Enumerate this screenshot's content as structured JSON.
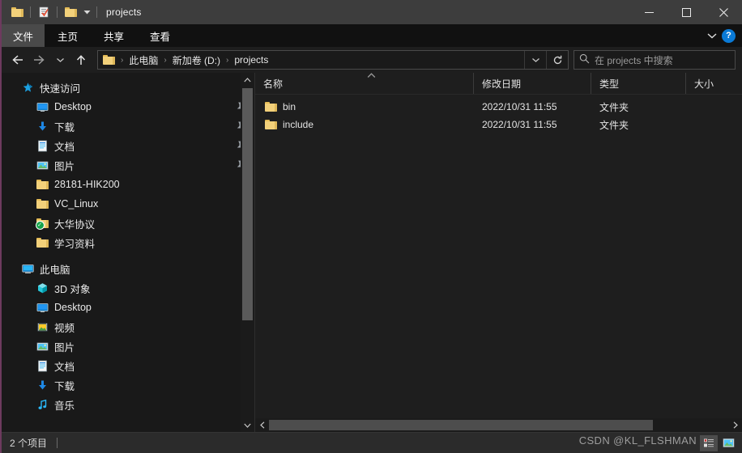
{
  "titlebar": {
    "title": "projects",
    "quick_access": [
      {
        "name": "folder-icon",
        "label": "folder"
      },
      {
        "name": "properties-icon",
        "label": "properties"
      },
      {
        "name": "new-folder-icon",
        "label": "new folder"
      }
    ],
    "minimize_label": "─",
    "maximize_label": "□",
    "close_label": "✕"
  },
  "ribbon": {
    "tabs": [
      {
        "label": "文件",
        "active": true
      },
      {
        "label": "主页",
        "active": false
      },
      {
        "label": "共享",
        "active": false
      },
      {
        "label": "查看",
        "active": false
      }
    ],
    "collapse_label": "⌄",
    "help_label": "?"
  },
  "address": {
    "back_label": "←",
    "forward_label": "→",
    "recent_label": "⌄",
    "up_label": "↑",
    "breadcrumb": [
      "此电脑",
      "新加卷 (D:)",
      "projects"
    ],
    "separator": "›",
    "history_label": "⌄",
    "refresh_label": "↻"
  },
  "search": {
    "placeholder": "在 projects 中搜索",
    "icon": "search-icon"
  },
  "sidebar": {
    "groups": [
      {
        "header": {
          "label": "快速访问",
          "icon": "star-pin-icon"
        },
        "items": [
          {
            "label": "Desktop",
            "icon": "monitor-icon",
            "pinned": true
          },
          {
            "label": "下载",
            "icon": "download-icon",
            "pinned": true
          },
          {
            "label": "文档",
            "icon": "document-icon",
            "pinned": true
          },
          {
            "label": "图片",
            "icon": "pictures-icon",
            "pinned": true
          },
          {
            "label": "28181-HIK200",
            "icon": "folder-icon",
            "pinned": false
          },
          {
            "label": "VC_Linux",
            "icon": "folder-icon",
            "pinned": false
          },
          {
            "label": "大华协议",
            "icon": "folder-synced-icon",
            "pinned": false
          },
          {
            "label": "学习资料",
            "icon": "folder-icon",
            "pinned": false
          }
        ]
      },
      {
        "header": {
          "label": "此电脑",
          "icon": "this-pc-icon"
        },
        "items": [
          {
            "label": "3D 对象",
            "icon": "3d-objects-icon",
            "pinned": false
          },
          {
            "label": "Desktop",
            "icon": "monitor-icon",
            "pinned": false
          },
          {
            "label": "视频",
            "icon": "video-icon",
            "pinned": false
          },
          {
            "label": "图片",
            "icon": "pictures-icon",
            "pinned": false
          },
          {
            "label": "文档",
            "icon": "document-icon",
            "pinned": false
          },
          {
            "label": "下载",
            "icon": "download-icon",
            "pinned": false
          },
          {
            "label": "音乐",
            "icon": "music-icon",
            "pinned": false
          }
        ]
      }
    ],
    "scroll_up_label": "⌃",
    "scroll_down_label": "⌄"
  },
  "filelist": {
    "columns": [
      {
        "label": "名称",
        "sorted": "asc"
      },
      {
        "label": "修改日期",
        "sorted": ""
      },
      {
        "label": "类型",
        "sorted": ""
      },
      {
        "label": "大小",
        "sorted": ""
      }
    ],
    "sort_caret": "⌃",
    "rows": [
      {
        "name": "bin",
        "date": "2022/10/31 11:55",
        "type": "文件夹",
        "size": "",
        "icon": "folder-icon"
      },
      {
        "name": "include",
        "date": "2022/10/31 11:55",
        "type": "文件夹",
        "size": "",
        "icon": "folder-icon"
      }
    ],
    "hscroll_left_label": "‹",
    "hscroll_right_label": "›"
  },
  "statusbar": {
    "item_count": "2 个项目",
    "views": [
      {
        "name": "details-view-button",
        "active": true
      },
      {
        "name": "large-icons-view-button",
        "active": false
      }
    ]
  },
  "watermark": {
    "text": "CSDN @KL_FLSHMAN"
  },
  "colors": {
    "titlebar": "#3d3d3d",
    "ribbon": "#111111",
    "window": "#1e1e1e",
    "sidebar": "#191919",
    "accent_blue": "#0a7ad6",
    "folder_yellow": "#f2d07a",
    "left_border": "#6d3a5e"
  }
}
